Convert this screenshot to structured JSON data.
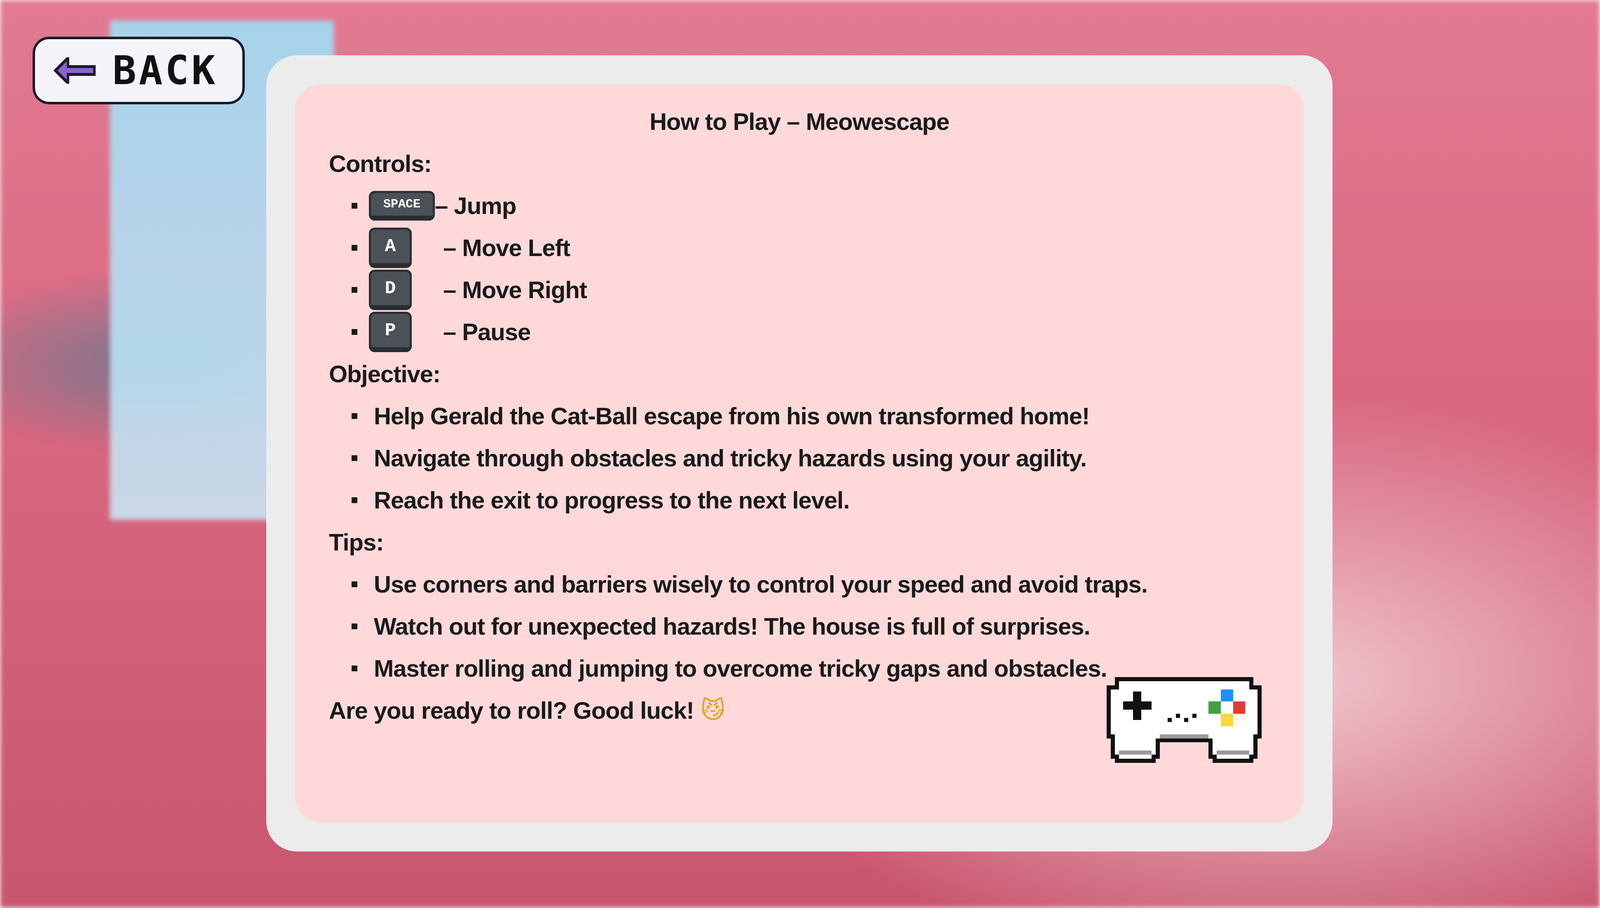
{
  "back_button": {
    "label": "BACK"
  },
  "title": "How to Play – Meowescape",
  "sections": [
    {
      "heading": "Controls:",
      "kind": "controls",
      "items": [
        {
          "key": "SPACE",
          "text": "– Jump",
          "kind": "wide"
        },
        {
          "key": "A",
          "text": "– Move Left",
          "kind": "square"
        },
        {
          "key": "D",
          "text": "– Move Right",
          "kind": "square"
        },
        {
          "key": "P",
          "text": "– Pause",
          "kind": "square"
        }
      ]
    },
    {
      "heading": "Objective:",
      "kind": "bullets",
      "items": [
        {
          "text": "Help Gerald the Cat-Ball escape from his own transformed home!"
        },
        {
          "text": "Navigate through obstacles and tricky hazards using your agility."
        },
        {
          "text": "Reach the exit to progress to the next level."
        }
      ]
    },
    {
      "heading": "Tips:",
      "kind": "bullets",
      "items": [
        {
          "text": "Use corners and barriers wisely to control your speed and avoid traps."
        },
        {
          "text": "Watch out for unexpected hazards! The house is full of surprises."
        },
        {
          "text": "Master rolling and jumping to overcome tricky gaps and obstacles."
        }
      ]
    }
  ],
  "closing": {
    "text": "Are you ready to roll? Good luck!",
    "emoji": "😼"
  }
}
